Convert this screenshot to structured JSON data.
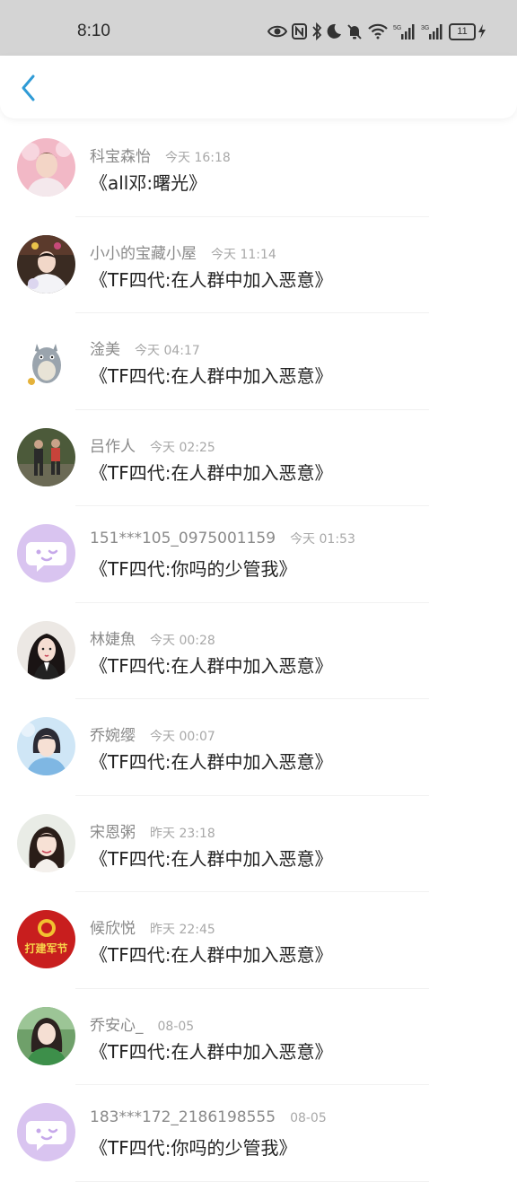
{
  "status_bar": {
    "time": "8:10",
    "battery": "11"
  },
  "header": {
    "back_icon": "chevron-left-icon",
    "accent": "#2f9bd6"
  },
  "messages": [
    {
      "name": "科宝森怡",
      "time": "今天 16:18",
      "title": "《all邓:曙光》"
    },
    {
      "name": "小小的宝藏小屋",
      "time": "今天 11:14",
      "title": "《TF四代:在人群中加入恶意》"
    },
    {
      "name": "淦美",
      "time": "今天 04:17",
      "title": "《TF四代:在人群中加入恶意》"
    },
    {
      "name": "吕作人",
      "time": "今天 02:25",
      "title": "《TF四代:在人群中加入恶意》"
    },
    {
      "name": "151***105_0975001159",
      "time": "今天 01:53",
      "title": "《TF四代:你吗的少管我》"
    },
    {
      "name": "林婕魚",
      "time": "今天 00:28",
      "title": "《TF四代:在人群中加入恶意》"
    },
    {
      "name": "乔婉缨",
      "time": "今天 00:07",
      "title": "《TF四代:在人群中加入恶意》"
    },
    {
      "name": "宋恩粥",
      "time": "昨天 23:18",
      "title": "《TF四代:在人群中加入恶意》"
    },
    {
      "name": "候欣悦",
      "time": "昨天 22:45",
      "title": "《TF四代:在人群中加入恶意》"
    },
    {
      "name": "乔安心_",
      "time": "08-05",
      "title": "《TF四代:在人群中加入恶意》"
    },
    {
      "name": "183***172_2186198555",
      "time": "08-05",
      "title": "《TF四代:你吗的少管我》"
    }
  ],
  "avatar_badge_text": "打建军节"
}
